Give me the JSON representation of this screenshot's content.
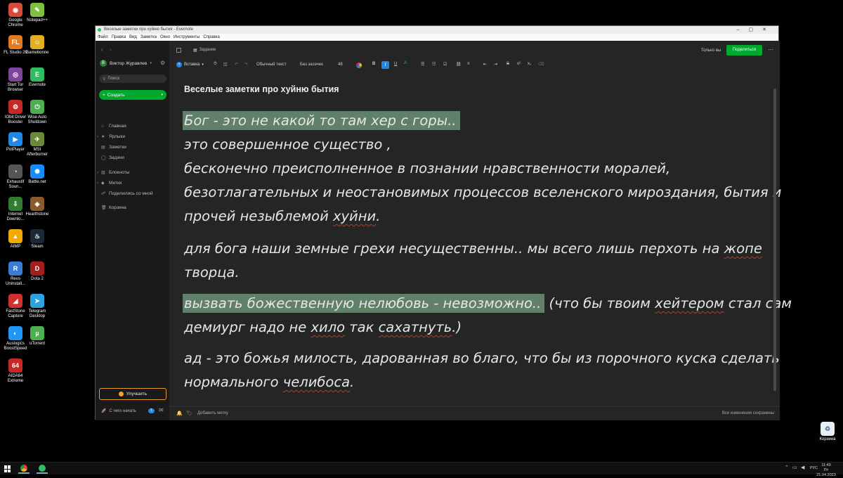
{
  "desktop": {
    "icons": [
      {
        "label": "Google Chrome",
        "glyph": "◉",
        "color": "#d64a3a"
      },
      {
        "label": "Notepad++",
        "glyph": "✎",
        "color": "#7fbf3f"
      },
      {
        "label": "FL Studio 20",
        "glyph": "FL",
        "color": "#e07b20"
      },
      {
        "label": "Gamebonne",
        "glyph": "☺",
        "color": "#e0b020"
      },
      {
        "label": "Start Tor Browser",
        "glyph": "◎",
        "color": "#7d4698"
      },
      {
        "label": "Evernote",
        "glyph": "E",
        "color": "#2dbe60"
      },
      {
        "label": "IObit Driver Booster",
        "glyph": "⚙",
        "color": "#c62828"
      },
      {
        "label": "Wise Auto Shutdown",
        "glyph": "⏻",
        "color": "#4caf50"
      },
      {
        "label": "PotPlayer",
        "glyph": "▶",
        "color": "#1e88e5"
      },
      {
        "label": "MSI Afterburner",
        "glyph": "✈",
        "color": "#6a8a3a"
      },
      {
        "label": "Exhaustif Soun...",
        "glyph": "◔",
        "color": "#555"
      },
      {
        "label": "Battle.net",
        "glyph": "✺",
        "color": "#148eff"
      },
      {
        "label": "Internet Downlo...",
        "glyph": "⇩",
        "color": "#2e7d32"
      },
      {
        "label": "Hearthstone",
        "glyph": "◈",
        "color": "#8a5a2a"
      },
      {
        "label": "AIMP",
        "glyph": "▲",
        "color": "#f2a900"
      },
      {
        "label": "Steam",
        "glyph": "♨",
        "color": "#1b2838"
      },
      {
        "label": "Revo Uninstall...",
        "glyph": "R",
        "color": "#3a7bd5"
      },
      {
        "label": "Dota 2",
        "glyph": "D",
        "color": "#a31d1d"
      },
      {
        "label": "FastStone Capture",
        "glyph": "◢",
        "color": "#d32f2f"
      },
      {
        "label": "Telegram Desktop",
        "glyph": "➤",
        "color": "#2aa3df"
      },
      {
        "label": "Auslogics BoostSpeed",
        "glyph": "◐",
        "color": "#2196f3"
      },
      {
        "label": "uTorrent",
        "glyph": "µ",
        "color": "#4caf50"
      },
      {
        "label": "AIDA64 Extreme",
        "glyph": "64",
        "color": "#c62828"
      }
    ],
    "recycle_bin": "Корзина"
  },
  "window": {
    "title": "Веселые заметки про хуйню бытия - Evernote",
    "menu": [
      "Файл",
      "Правка",
      "Вид",
      "Заметка",
      "Окно",
      "Инструменты",
      "Справка"
    ]
  },
  "sidebar": {
    "account": "Виктор Журавлев",
    "search_placeholder": "Поиск",
    "create_label": "Создать",
    "nav": [
      {
        "label": "Главная",
        "icon": "home-icon",
        "glyph": "⌂"
      },
      {
        "label": "Ярлыки",
        "icon": "star-icon",
        "glyph": "★"
      },
      {
        "label": "Заметки",
        "icon": "notes-icon",
        "glyph": "▤"
      },
      {
        "label": "Задачи",
        "icon": "tasks-icon",
        "glyph": "◯"
      },
      {
        "label": "Блокноты",
        "icon": "notebook-icon",
        "glyph": "▥"
      },
      {
        "label": "Метки",
        "icon": "tag-icon",
        "glyph": "◆"
      },
      {
        "label": "Поделились со мной",
        "icon": "shared-icon",
        "glyph": "☍"
      },
      {
        "label": "Корзина",
        "icon": "trash-icon",
        "glyph": "🗑"
      }
    ],
    "upgrade_label": "Улучшить",
    "getting_started": "С чего начать",
    "badge": "1"
  },
  "toolbar": {
    "task_label": "Задание",
    "only_you": "Только вы",
    "share_label": "Поделиться",
    "insert_label": "Вставка",
    "style_label": "Обычный текст",
    "font_label": "Без засечек",
    "size_label": "48"
  },
  "note": {
    "title": "Веселые заметки про хуйню бытия",
    "l1": "Бог - это не какой то там хер с горы..",
    "l2": "это совершенное существо ,",
    "l3": "бесконечно преисполненное в познании нравственности моралей,",
    "l4": "безотлагательных и неостановимых процессов вселенского мироздания, бытия и",
    "l5a": "прочей незыблемой ",
    "l5b": "хуйни",
    "l5c": ".",
    "l6a": "для бога наши земные грехи несущественны.. мы всего лишь перхоть на ",
    "l6b": "жопе",
    "l7": "творца.",
    "l8a": "вызвать божественную нелюбовь - невозможно..",
    "l8b": " (что бы твоим ",
    "l8c": "хейтером",
    "l8d": " стал сам",
    "l9a": "демиург надо не ",
    "l9b": "хило",
    "l9c": " так ",
    "l9d": "сахатнуть",
    "l9e": ".)",
    "l10": "ад - это божья милость, дарованная во благо, что бы из порочного куска сделать",
    "l11a": "нормального ",
    "l11b": "челибоса",
    "l11c": "."
  },
  "footer": {
    "add_tag": "Добавить метку",
    "saved": "Все изменения сохранены"
  },
  "taskbar": {
    "time": "11:49",
    "date": "Пт 21.04.2023",
    "lang": "РУС"
  }
}
